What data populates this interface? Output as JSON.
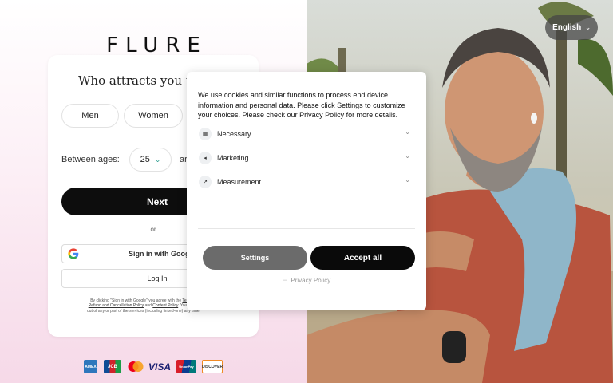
{
  "brand": {
    "logo_text": "FLURE"
  },
  "language": {
    "label": "English",
    "chevron_icon": "chevron-down-icon"
  },
  "signup": {
    "title": "Who attracts you the",
    "gender_options": [
      "Men",
      "Women"
    ],
    "age_label": "Between ages:",
    "age_from": "25",
    "age_and": "ar",
    "next_label": "Next",
    "or_label": "or",
    "google_label": "Sign in with Googl",
    "login_label": "Log In",
    "legal": {
      "line1": "By clicking \"Sign in with Google\" you agree with the",
      "terms": "Terms &",
      "refund": "Refund and Cancellation Policy",
      "and": "and",
      "content": "Content Policy",
      "line2_tail": ". You can te",
      "line3": "out of any or part of the services (including linked-one) any time."
    }
  },
  "locale_short": "EN",
  "payments": [
    "AMEX",
    "JCB",
    "mastercard",
    "VISA",
    "UnionPay",
    "DISCOVER"
  ],
  "cookie": {
    "text": "We use cookies and similar functions to process end device information and personal data. Please click Settings to customize your choices. Please check our Privacy Policy for more details.",
    "options": [
      {
        "label": "Necessary",
        "icon": "shield-icon"
      },
      {
        "label": "Marketing",
        "icon": "megaphone-icon"
      },
      {
        "label": "Measurement",
        "icon": "chart-icon"
      }
    ],
    "settings_label": "Settings",
    "accept_label": "Accept all",
    "privacy_label": "Privacy Policy"
  },
  "colors": {
    "accent_dark": "#0a0a0a",
    "pink_bg": "#f6d9e8",
    "settings_gray": "#6b6b6b"
  }
}
